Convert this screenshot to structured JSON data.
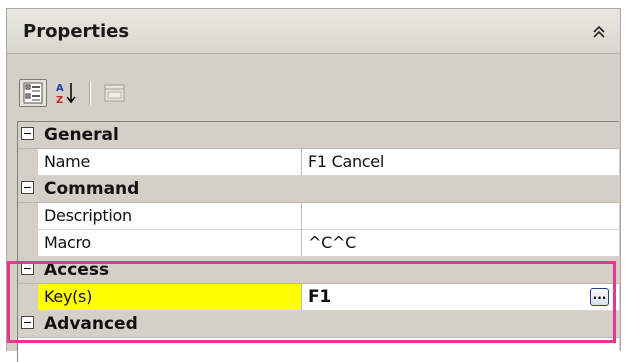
{
  "panel": {
    "title": "Properties",
    "collapse_icon": "double-chevron-up-icon"
  },
  "toolbar": {
    "buttons": [
      {
        "icon": "categorized-view-icon",
        "active": true
      },
      {
        "icon": "alphabetical-sort-icon",
        "active": false
      },
      {
        "icon": "property-pages-icon",
        "active": false,
        "disabled": true
      }
    ]
  },
  "grid": {
    "categories": {
      "general": "General",
      "command": "Command",
      "access": "Access",
      "advanced": "Advanced"
    },
    "properties": {
      "name": {
        "label": "Name",
        "value": "F1 Cancel"
      },
      "description": {
        "label": "Description",
        "value": ""
      },
      "macro": {
        "label": "Macro",
        "value": "^C^C"
      },
      "keys": {
        "label": "Key(s)",
        "value": "F1",
        "button": "..."
      }
    }
  },
  "colors": {
    "highlight_border": "#e8368f",
    "selected_name_bg": "#ffff00",
    "panel_bg": "#d4d0c8"
  }
}
